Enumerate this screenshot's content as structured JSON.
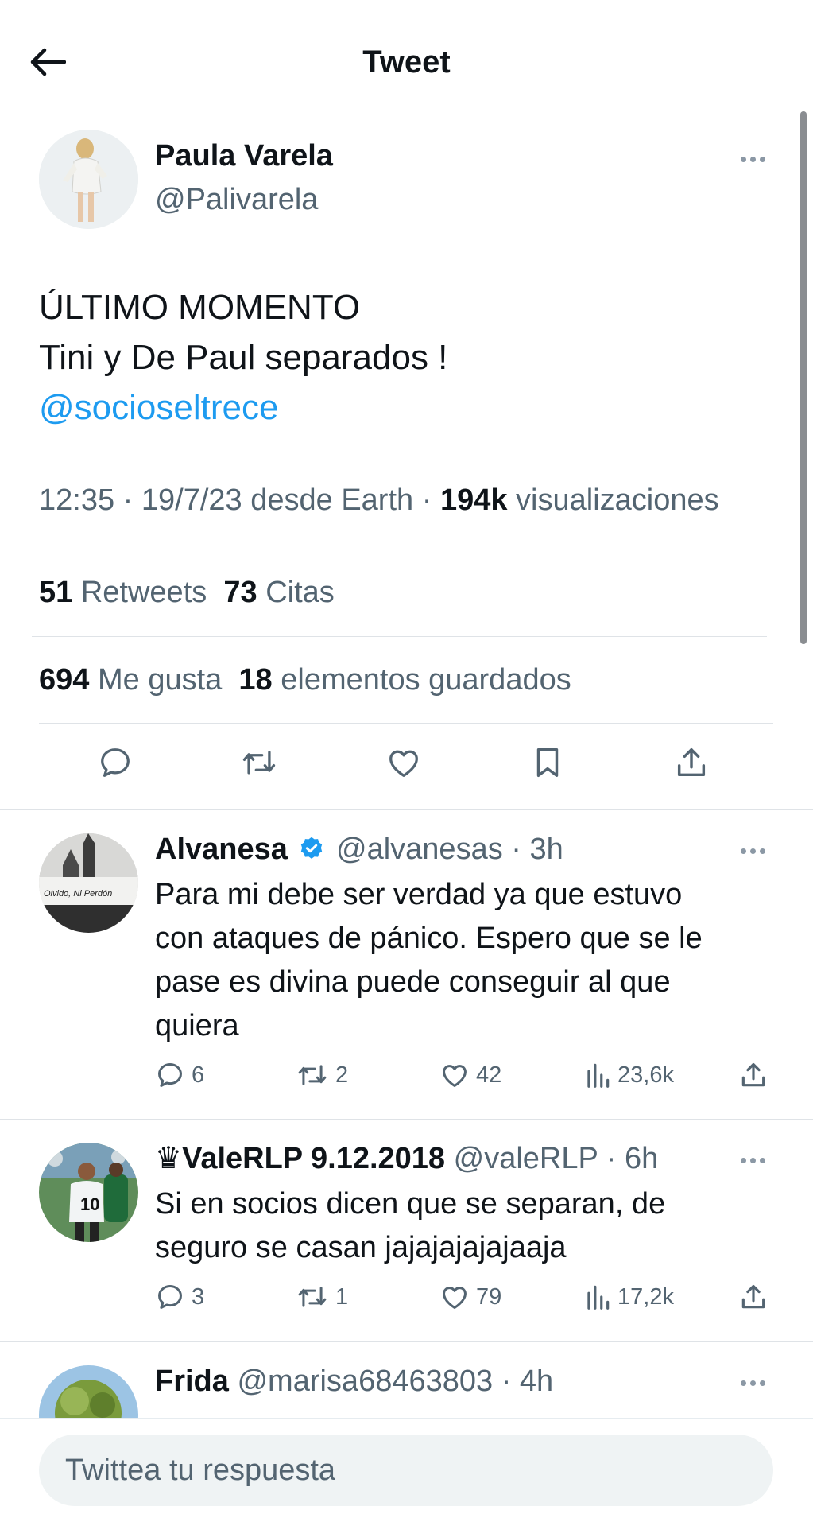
{
  "header": {
    "title": "Tweet"
  },
  "tweet": {
    "author_name": "Paula Varela",
    "author_handle": "@Palivarela",
    "lines": [
      "ÚLTIMO MOMENTO",
      "Tini y De Paul separados !"
    ],
    "mention": "@socioseltrece",
    "time": "12:35",
    "date": "19/7/23",
    "source": "desde Earth",
    "views_count": "194k",
    "views_label": "visualizaciones",
    "retweets_count": "51",
    "retweets_label": "Retweets",
    "quotes_count": "73",
    "quotes_label": "Citas",
    "likes_count": "694",
    "likes_label": "Me gusta",
    "bookmarks_count": "18",
    "bookmarks_label": "elementos guardados"
  },
  "replies": [
    {
      "name": "Alvanesa",
      "verified": true,
      "handle": "@alvanesas",
      "time": "3h",
      "avatar_sign_text": "Olvido, Ni Perdón",
      "lines": [
        "Para mi debe ser verdad ya que estuvo",
        "con ataques de pánico. Espero que se le",
        "pase es divina puede conseguir al que",
        "quiera"
      ],
      "replies": "6",
      "retweets": "2",
      "likes": "42",
      "views": "23,6k"
    },
    {
      "name": "♛ValeRLP 9.12.2018",
      "handle": "@valeRLP",
      "time": "6h",
      "avatar_jersey_number": "10",
      "lines": [
        "Si en socios dicen que se separan, de",
        "seguro se casan jajajajajajaaja"
      ],
      "replies": "3",
      "retweets": "1",
      "likes": "79",
      "views": "17,2k"
    },
    {
      "name": "Frida",
      "handle": "@marisa68463803",
      "time": "4h"
    }
  ],
  "compose": {
    "placeholder": "Twittea tu respuesta"
  },
  "colors": {
    "accent": "#1d9bf0",
    "verified": "#1d9bf0",
    "text": "#0f1419",
    "secondary": "#536471",
    "divider": "#dfe3e7"
  }
}
